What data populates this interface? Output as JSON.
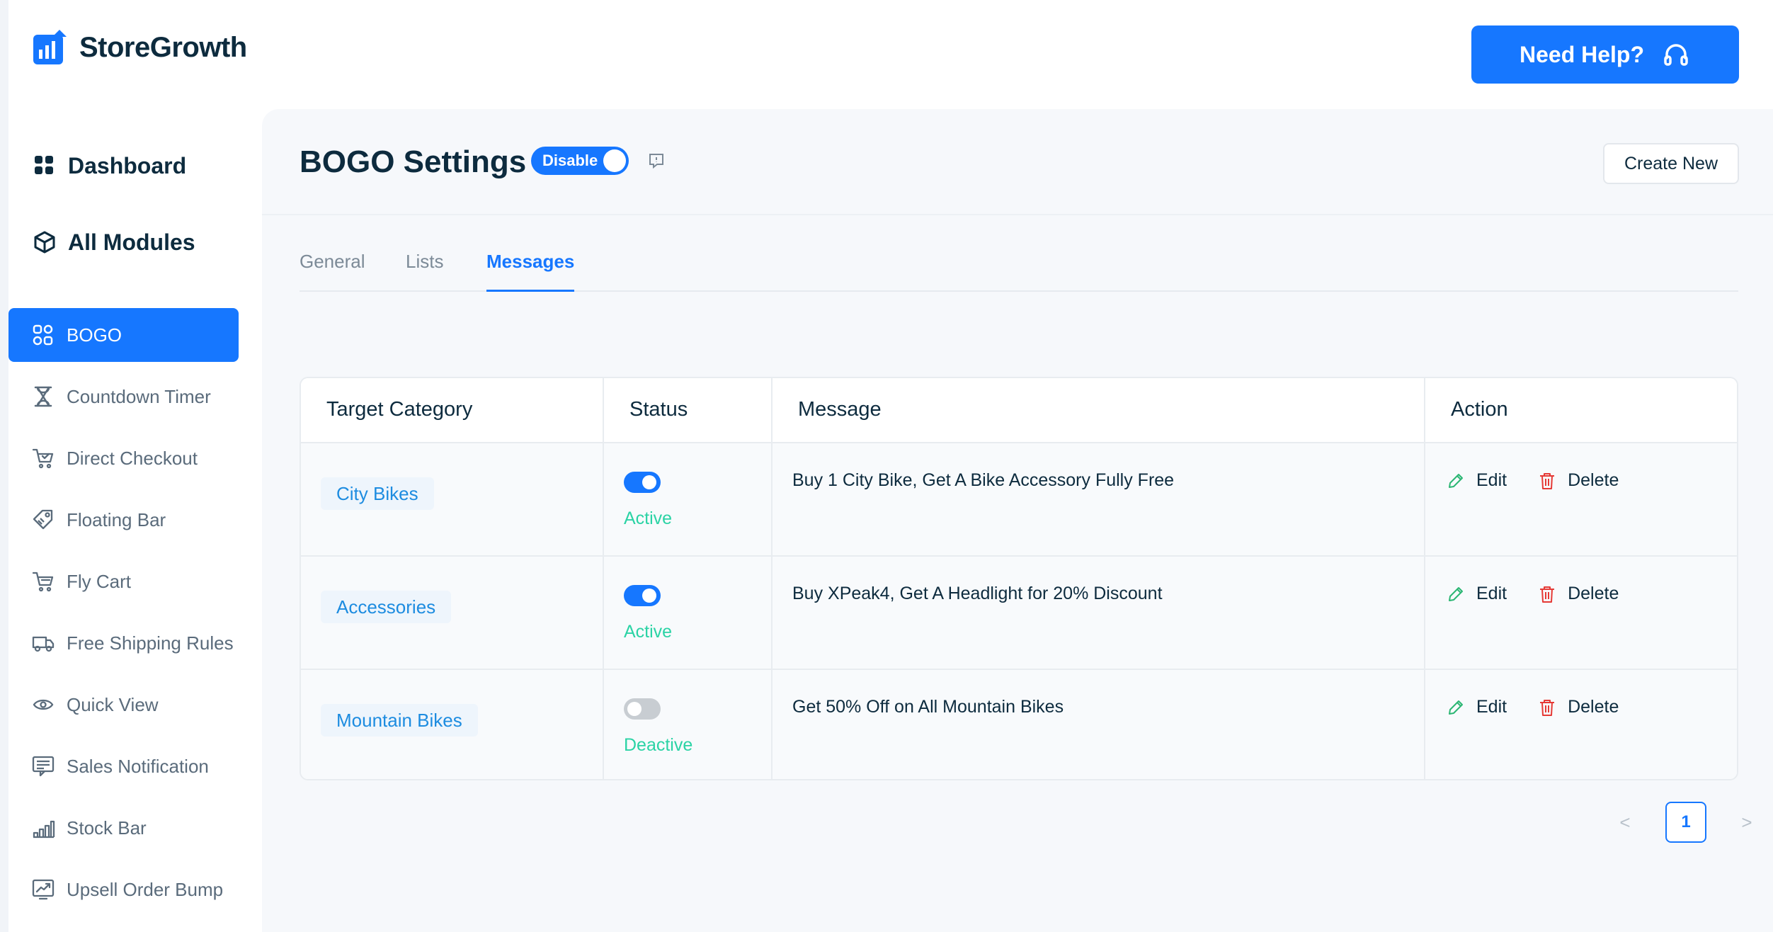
{
  "brand": {
    "name": "StoreGrowth",
    "accent": "#1677ff"
  },
  "header": {
    "help_label": "Need Help?",
    "help_icon": "headset-icon"
  },
  "sidebar": {
    "main_items": [
      {
        "label": "Dashboard",
        "icon": "grid-icon"
      },
      {
        "label": "All Modules",
        "icon": "cube-icon"
      }
    ],
    "modules": [
      {
        "label": "BOGO",
        "icon": "bogo-icon",
        "active": true
      },
      {
        "label": "Countdown Timer",
        "icon": "hourglass-icon"
      },
      {
        "label": "Direct Checkout",
        "icon": "cart-check-icon"
      },
      {
        "label": "Floating Bar",
        "icon": "tag-icon"
      },
      {
        "label": "Fly Cart",
        "icon": "cart-icon"
      },
      {
        "label": "Free Shipping Rules",
        "icon": "truck-icon"
      },
      {
        "label": "Quick View",
        "icon": "eye-icon"
      },
      {
        "label": "Sales Notification",
        "icon": "notification-icon"
      },
      {
        "label": "Stock Bar",
        "icon": "bar-chart-icon"
      },
      {
        "label": "Upsell Order Bump",
        "icon": "trend-up-icon"
      }
    ]
  },
  "page": {
    "title": "BOGO Settings",
    "toggle_label": "Disable",
    "toggle_on": true,
    "create_label": "Create New"
  },
  "tabs": [
    {
      "label": "General",
      "active": false
    },
    {
      "label": "Lists",
      "active": false
    },
    {
      "label": "Messages",
      "active": true
    }
  ],
  "table": {
    "columns": [
      "Target Category",
      "Status",
      "Message",
      "Action"
    ],
    "rows": [
      {
        "category": "City Bikes",
        "enabled": true,
        "status": "Active",
        "message": "Buy 1 City Bike, Get A Bike Accessory Fully Free"
      },
      {
        "category": "Accessories",
        "enabled": true,
        "status": "Active",
        "message": "Buy XPeak4, Get A Headlight for 20% Discount"
      },
      {
        "category": "Mountain Bikes",
        "enabled": false,
        "status": "Deactive",
        "message": "Get 50% Off on All Mountain Bikes"
      }
    ],
    "edit_label": "Edit",
    "delete_label": "Delete"
  },
  "pagination": {
    "current": "1",
    "prev": "<",
    "next": ">"
  }
}
